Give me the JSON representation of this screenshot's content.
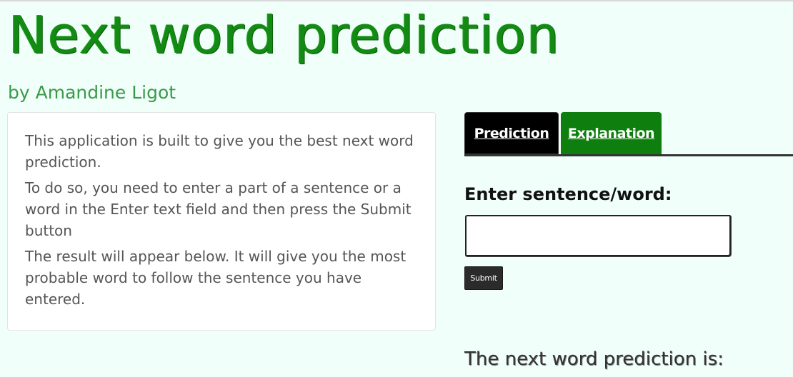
{
  "header": {
    "title": "Next word prediction",
    "author": "by Amandine Ligot"
  },
  "sidebar": {
    "paragraphs": [
      "This application is built to give you the best next word prediction.",
      "To do so, you need to enter a part of a sentence or a word in the Enter text field and then press the Submit button",
      "The result will appear below. It will give you the most probable word to follow the sentence you have entered."
    ]
  },
  "tabs": [
    {
      "label": "Prediction",
      "active": true
    },
    {
      "label": "Explanation",
      "active": false
    }
  ],
  "form": {
    "label": "Enter sentence/word:",
    "input_value": "",
    "submit_label": "Submit"
  },
  "result": {
    "label": "The next word prediction is:"
  },
  "colors": {
    "background": "#f0fff9",
    "title_green": "#138a13",
    "subtitle_green": "#3a9a4a",
    "active_tab": "#000000",
    "inactive_tab": "#0e7f0e"
  }
}
